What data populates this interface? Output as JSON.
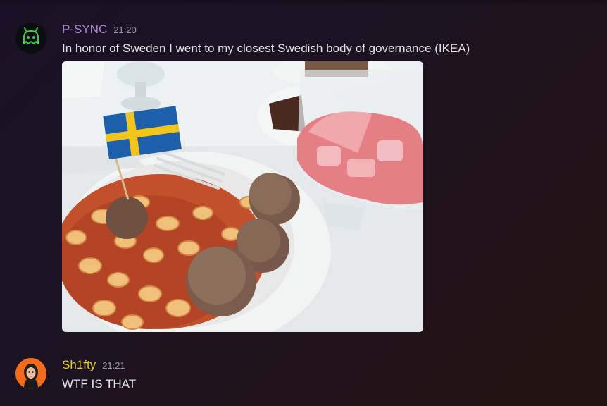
{
  "messages": [
    {
      "username": "P-SYNC",
      "timestamp": "21:20",
      "text": "In honor of Sweden I went to my closest Swedish body of governance (IKEA)",
      "avatar_icon": "alien-ghost-icon",
      "username_color": "#a98bd8",
      "attachment": "photo"
    },
    {
      "username": "Sh1fty",
      "timestamp": "21:21",
      "text": "WTF IS THAT",
      "avatar_icon": "person-portrait",
      "username_color": "#e4d21d"
    }
  ]
}
